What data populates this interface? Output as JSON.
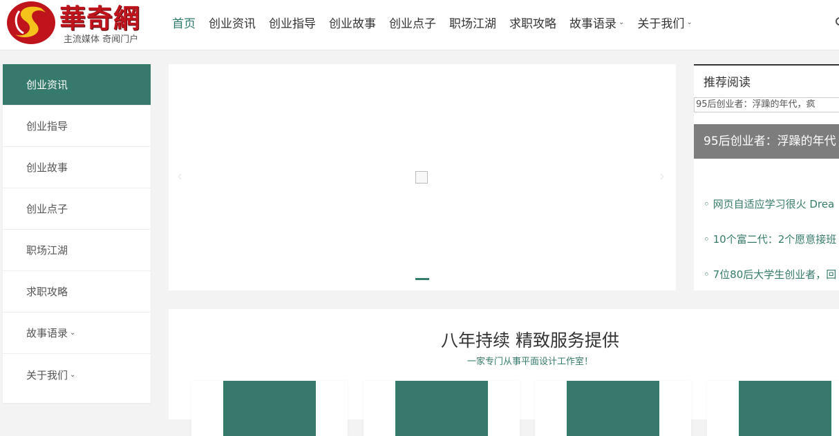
{
  "brand": {
    "name": "華奇網",
    "tagline": "主流媒体 奇闻门户",
    "colors": {
      "primary": "#357a6a",
      "logo_red": "#c0141c"
    }
  },
  "nav": {
    "items": [
      {
        "label": "首页",
        "active": true
      },
      {
        "label": "创业资讯"
      },
      {
        "label": "创业指导"
      },
      {
        "label": "创业故事"
      },
      {
        "label": "创业点子"
      },
      {
        "label": "职场江湖"
      },
      {
        "label": "求职攻略"
      },
      {
        "label": "故事语录",
        "dropdown": true
      },
      {
        "label": "关于我们",
        "dropdown": true
      }
    ]
  },
  "sidebar": {
    "items": [
      {
        "label": "创业资讯",
        "active": true
      },
      {
        "label": "创业指导"
      },
      {
        "label": "创业故事"
      },
      {
        "label": "创业点子"
      },
      {
        "label": "职场江湖"
      },
      {
        "label": "求职攻略"
      },
      {
        "label": "故事语录",
        "dropdown": true
      },
      {
        "label": "关于我们",
        "dropdown": true
      }
    ]
  },
  "slider": {
    "prev": "‹",
    "next": "›"
  },
  "recommended": {
    "title": "推荐阅读",
    "image_alt": "95后创业者：浮躁的年代，疯",
    "caption": "95后创业者：浮躁的年代",
    "links": [
      "◦ 网页自适应学习很火 Drea",
      "◦ 10个富二代：2个愿意接班",
      "◦ 7位80后大学生创业者，回"
    ]
  },
  "services": {
    "title": "八年持续 精致服务提供",
    "subtitle": "一家专门从事平面设计工作室！"
  }
}
